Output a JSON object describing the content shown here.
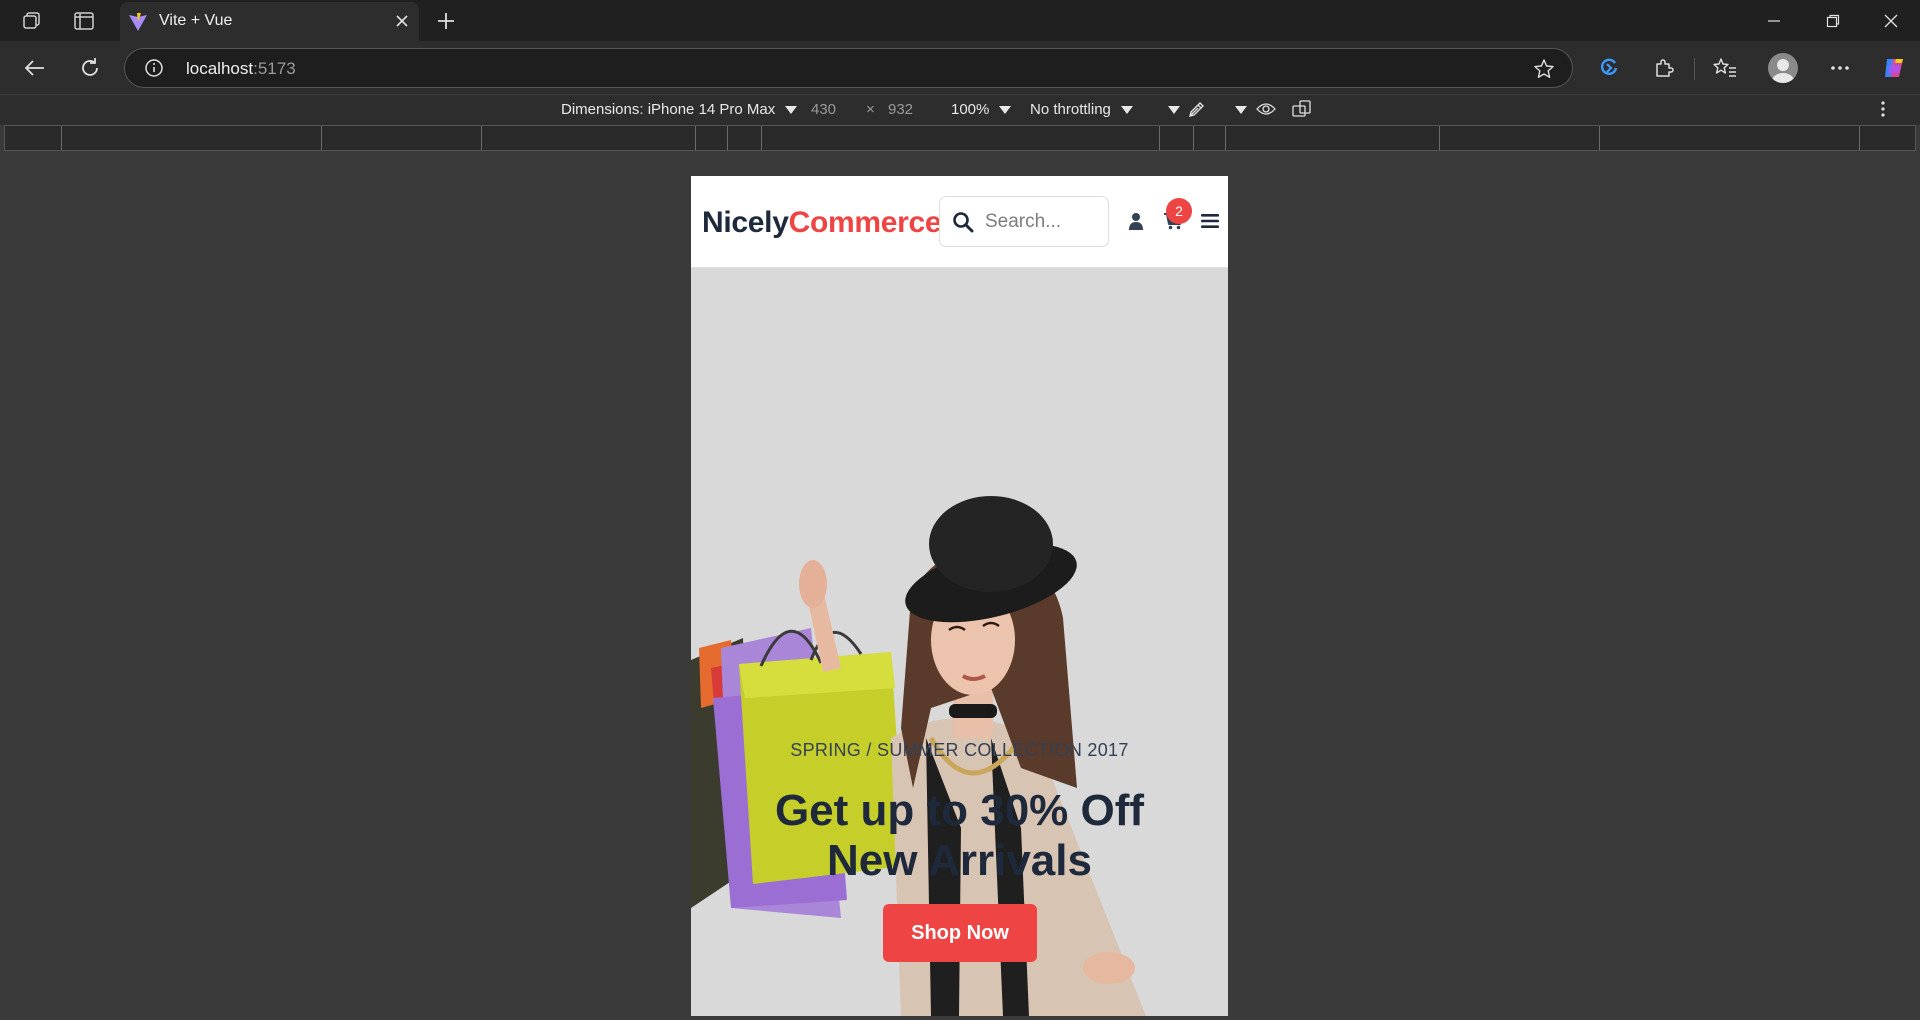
{
  "browser": {
    "tab": {
      "title": "Vite + Vue"
    },
    "address": {
      "host": "localhost",
      "port": ":5173"
    }
  },
  "devtools": {
    "dimensions_label": "Dimensions: iPhone 14 Pro Max",
    "width": "430",
    "times": "×",
    "height": "932",
    "zoom": "100%",
    "throttling": "No throttling"
  },
  "site": {
    "logo_part1": "Nicely",
    "logo_part2": "Commerce",
    "search_placeholder": "Search...",
    "cart_count": "2",
    "hero": {
      "subtitle": "SPRING / SUMMER COLLECTION 2017",
      "title_line1": "Get up to 30% Off",
      "title_line2": "New Arrivals",
      "cta": "Shop Now"
    }
  },
  "colors": {
    "brand_dark": "#1e293b",
    "brand_accent": "#ef4444",
    "browser_bg": "#202020"
  }
}
